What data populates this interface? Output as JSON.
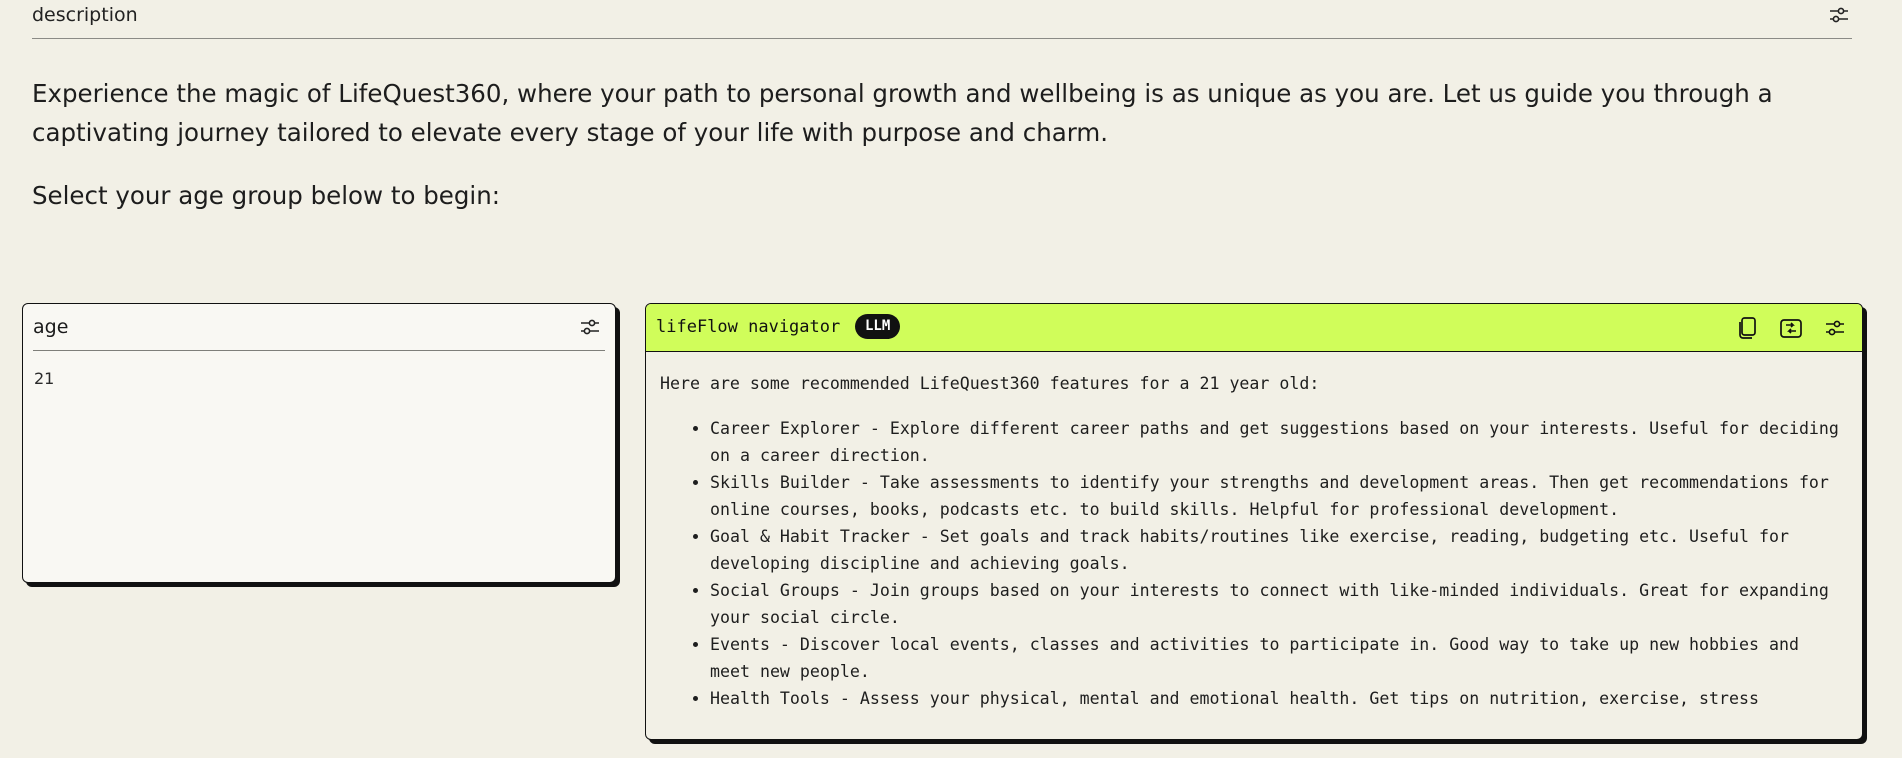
{
  "description": {
    "label": "description",
    "intro": "Experience the magic of LifeQuest360, where your path to personal growth and wellbeing is as unique as you are. Let us guide you through a captivating journey tailored to elevate every stage of your life with purpose and charm.",
    "prompt": "Select your age group below to begin:"
  },
  "age": {
    "label": "age",
    "value": "21"
  },
  "navigator": {
    "title": "lifeFlow navigator",
    "badge": "LLM",
    "intro": "Here are some recommended LifeQuest360 features for a 21 year old:",
    "features": [
      "Career Explorer - Explore different career paths and get suggestions based on your interests. Useful for deciding on a career direction.",
      "Skills Builder - Take assessments to identify your strengths and development areas. Then get recommendations for online courses, books, podcasts etc. to build skills. Helpful for professional development.",
      "Goal & Habit Tracker - Set goals and track habits/routines like exercise, reading, budgeting etc. Useful for developing discipline and achieving goals.",
      "Social Groups - Join groups based on your interests to connect with like-minded individuals. Great for expanding your social circle.",
      "Events - Discover local events, classes and activities to participate in. Good way to take up new hobbies and meet new people.",
      "Health Tools - Assess your physical, mental and emotional health. Get tips on nutrition, exercise, stress"
    ]
  },
  "icons": {
    "settings": "sliders-icon",
    "copy": "copy-icon",
    "regenerate": "regenerate-icon"
  },
  "colors": {
    "background": "#f2f0e6",
    "accent": "#d0fd5a",
    "badge": "#111111"
  }
}
